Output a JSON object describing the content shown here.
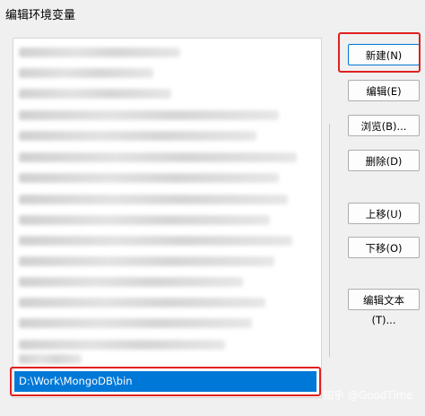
{
  "dialog": {
    "title": "编辑环境变量"
  },
  "list": {
    "selected_item": "D:\\Work\\MongoDB\\bin"
  },
  "buttons": {
    "new": "新建(N)",
    "edit": "编辑(E)",
    "browse": "浏览(B)...",
    "delete": "删除(D)",
    "move_up": "上移(U)",
    "move_down": "下移(O)",
    "edit_text": "编辑文本(T)..."
  },
  "watermark": "知乎 @GoodTime",
  "colors": {
    "highlight": "#e02020",
    "selection": "#0078d7"
  }
}
